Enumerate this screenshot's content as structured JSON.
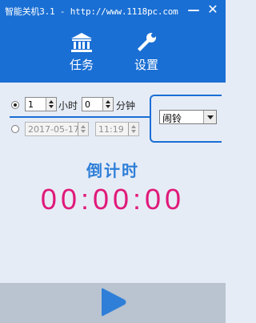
{
  "window": {
    "title": "智能关机3.1 - http://www.1118pc.com",
    "minimize_glyph": "—",
    "close_glyph": "✕",
    "accent_color": "#1a6fd4"
  },
  "nav": {
    "tasks": {
      "label": "任务",
      "icon": "bank-icon"
    },
    "settings": {
      "label": "设置",
      "icon": "wrench-icon"
    }
  },
  "timer_mode": {
    "selected": true,
    "hours_value": "1",
    "hours_unit": "小时",
    "minutes_value": "0",
    "minutes_unit": "分钟"
  },
  "date_mode": {
    "selected": false,
    "date_value": "2017-05-17",
    "time_value": "11:19"
  },
  "action": {
    "selected_value": "闹铃"
  },
  "countdown": {
    "label": "倒计时",
    "time": "00:00:00",
    "time_color": "#e0197a"
  },
  "footer": {
    "start_icon": "play-icon"
  }
}
